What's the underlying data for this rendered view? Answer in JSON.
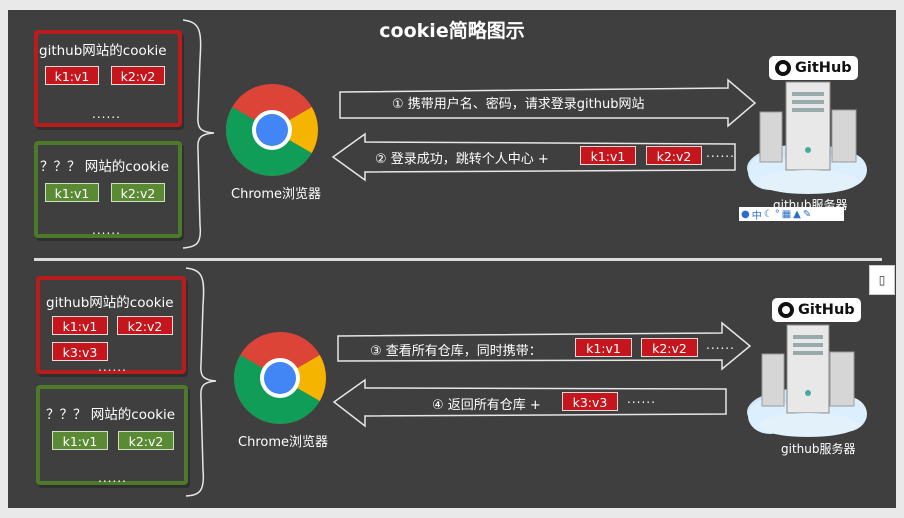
{
  "title": "cookie简略图示",
  "top": {
    "box_github": {
      "title": "github网站的cookie",
      "chips": [
        "k1:v1",
        "k2:v2"
      ],
      "dots": "......"
    },
    "box_other": {
      "title": "？？？ 网站的cookie",
      "chips": [
        "k1:v1",
        "k2:v2"
      ],
      "dots": "......"
    },
    "browser_label": "Chrome浏览器",
    "arrow_right_text": "① 携带用户名、密码，请求登录github网站",
    "arrow_left_text": "② 登录成功，跳转个人中心 +",
    "arrow_left_chips": [
      "k1:v1",
      "k2:v2"
    ],
    "arrow_left_dots": "......",
    "server_label": "github服务器",
    "github_badge": "GitHub"
  },
  "bottom": {
    "box_github": {
      "title": "github网站的cookie",
      "chips": [
        "k1:v1",
        "k2:v2",
        "k3:v3"
      ],
      "dots": "......"
    },
    "box_other": {
      "title": "？？？ 网站的cookie",
      "chips": [
        "k1:v1",
        "k2:v2"
      ],
      "dots": "......"
    },
    "browser_label": "Chrome浏览器",
    "arrow_right_text": "③ 查看所有仓库，同时携带：",
    "arrow_right_chips": [
      "k1:v1",
      "k2:v2"
    ],
    "arrow_right_dots": "......",
    "arrow_left_text": "④ 返回所有仓库 +",
    "arrow_left_chips": [
      "k3:v3"
    ],
    "arrow_left_dots": "......",
    "server_label": "github服务器",
    "github_badge": "GitHub"
  },
  "ime_toolbar": {
    "item": "中"
  },
  "side_tab_icon": "bookmark-icon",
  "colors": {
    "slide_bg": "#3f3f3f",
    "chip_red": "#c4161c",
    "chip_green": "#5a8a34",
    "box_red": "#b81c1c",
    "box_green": "#4d7a2a"
  }
}
